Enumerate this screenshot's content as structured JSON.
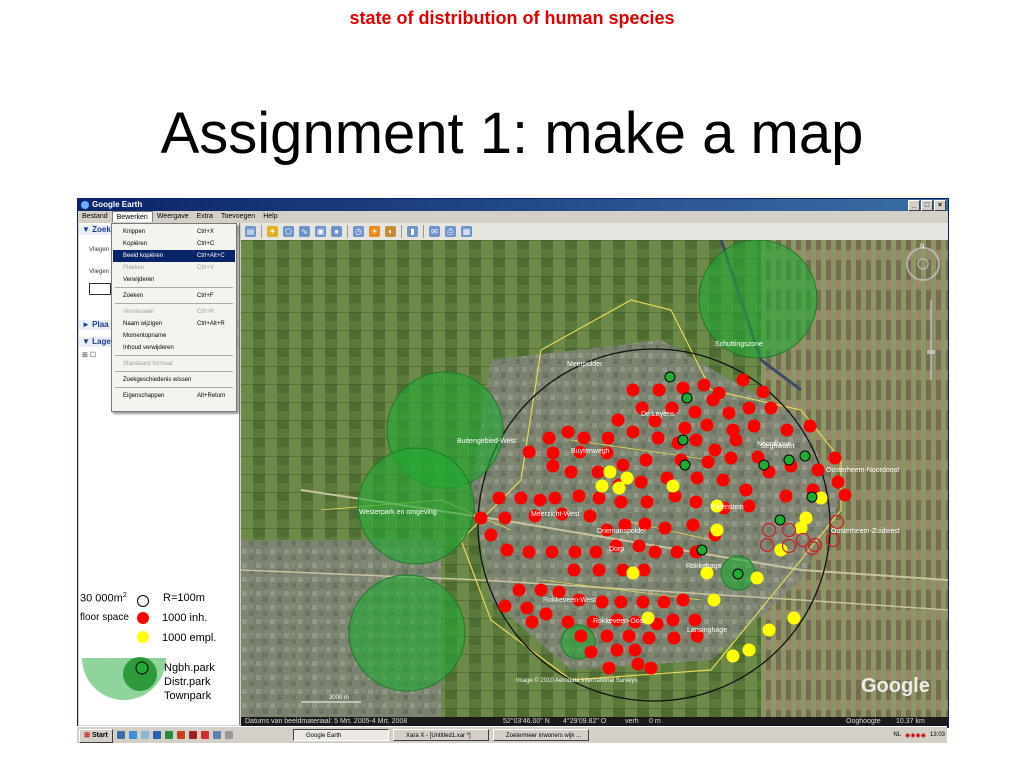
{
  "slide": {
    "subtitle": "state of distribution of human species",
    "title": "Assignment 1: make a map"
  },
  "window": {
    "title": "Google Earth",
    "menu": [
      "Bestand",
      "Bewerken",
      "Weergave",
      "Extra",
      "Toevoegen",
      "Help"
    ],
    "open_menu": "Bewerken"
  },
  "sidebar": {
    "search_header": "Zoek",
    "fly_to_label": "Vliegen",
    "fly_to_label2": "Vliegen",
    "places_header": "Plaa",
    "layers_header": "Lage"
  },
  "dropdown": {
    "items": [
      {
        "label": "Knippen",
        "shortcut": "Ctrl+X",
        "state": "normal"
      },
      {
        "label": "Kopiëren",
        "shortcut": "Ctrl+C",
        "state": "normal"
      },
      {
        "label": "Beeld kopiëren",
        "shortcut": "Ctrl+Alt+C",
        "state": "highlighted"
      },
      {
        "label": "Plakken",
        "shortcut": "Ctrl+V",
        "state": "disabled"
      },
      {
        "label": "Verwijderen",
        "shortcut": "",
        "state": "normal"
      },
      {
        "label": "Zoeken",
        "shortcut": "Ctrl+F",
        "state": "normal"
      },
      {
        "label": "Vernieuwen",
        "shortcut": "Ctrl+R",
        "state": "disabled"
      },
      {
        "label": "Naam wijzigen",
        "shortcut": "Ctrl+Alt+R",
        "state": "normal"
      },
      {
        "label": "Momentopname",
        "shortcut": "",
        "state": "normal"
      },
      {
        "label": "Inhoud verwijderen",
        "shortcut": "",
        "state": "normal"
      },
      {
        "label": "Standaard formaat",
        "shortcut": "",
        "state": "disabled"
      },
      {
        "label": "Zoekgeschiedenis wissen",
        "shortcut": "",
        "state": "normal"
      },
      {
        "label": "Eigenschappen",
        "shortcut": "Alt+Return",
        "state": "normal"
      }
    ]
  },
  "map": {
    "place_labels": [
      "Meerpolder",
      "De Leyens",
      "Buytenwegh",
      "Seghwaert",
      "Noordhove",
      "Buitengebied-West",
      "Westerpark en omgeving",
      "Meerzicht-West",
      "Driemanspolder",
      "Palenstein",
      "Oosterheem-Noordoost",
      "Oosterheem-Zuidwest",
      "Rokkehage",
      "Rokkeveen-West",
      "Rokkeveen-Oost",
      "Lansinghage",
      "Schuttingszone",
      "Dorp"
    ],
    "copyright": "Image © 2010 Aerodata International Surveys",
    "brand": "Google",
    "scale_label": "3000 m",
    "colors": {
      "inhabitants": "#ff0000",
      "employees": "#ffff00",
      "park": "#22aa33"
    }
  },
  "statusbar": {
    "date": "Datums van beeldmateriaal: 5 Mrt. 2005-4 Mrt. 2008",
    "lat": "52°03'46.00\" N",
    "lon": "4°29'09.82\" O",
    "elev_label": "verh",
    "elev": "0 m",
    "eye_label": "Ooghoogte",
    "eye": "10.37 km"
  },
  "taskbar": {
    "start": "Start",
    "buttons": [
      "Google Earth",
      "Xara X - [Untitled1.xar *]",
      "Zoetermeer inwoners wijk ..."
    ],
    "lang": "NL",
    "time": "13:03"
  },
  "legend": {
    "floor_space_amount": "30 000m",
    "superscript": "2",
    "radius": "R=100m",
    "floor_space": "floor space",
    "inhabitants": "1000 inh.",
    "employees": "1000 empl.",
    "nbh_park": "Ngbh.park",
    "distr_park": "Distr.park",
    "town_park": "Townpark"
  }
}
